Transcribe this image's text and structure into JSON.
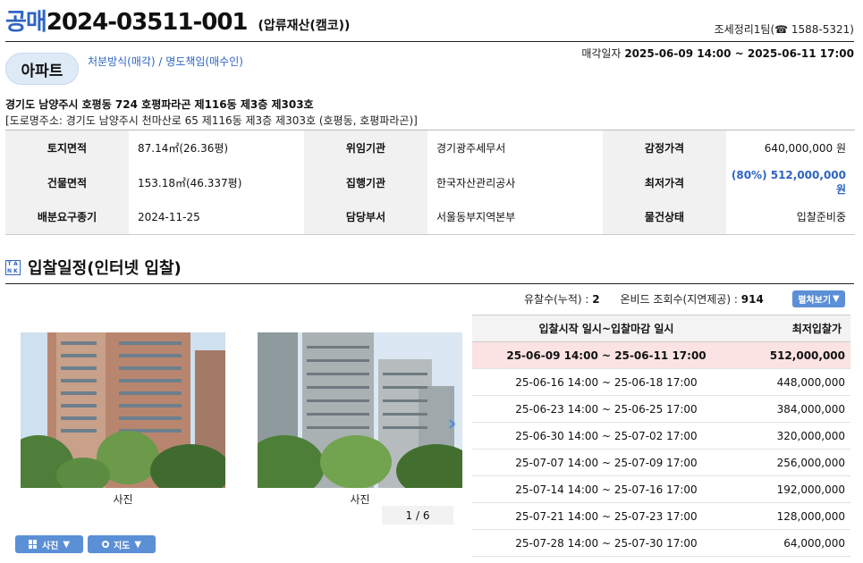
{
  "header": {
    "type_label": "공매",
    "case_number": "2024-03511-001",
    "subtitle": "(압류재산(캠코))",
    "contact": "조세정리1팀(☎ 1588-5321)"
  },
  "badge": {
    "label": "아파트"
  },
  "disposal": "처분방식(매각) / 명도책임(매수인)",
  "sale_period": {
    "label": "매각일자",
    "value": "2025-06-09 14:00 ~ 2025-06-11 17:00"
  },
  "address": {
    "lot": "경기도 남양주시 호평동 724 호평파라곤 제116동 제3층 제303호",
    "road": "[도로명주소: 경기도 남양주시 천마산로 65 제116동 제3층 제303호 (호평동, 호평파라곤)]"
  },
  "info": {
    "land_area_label": "토지면적",
    "land_area": "87.14㎡(26.36평)",
    "delegator_label": "위임기관",
    "delegator": "경기광주세무서",
    "appraisal_label": "감정가격",
    "appraisal": "640,000,000 원",
    "building_area_label": "건물면적",
    "building_area": "153.18㎡(46.337평)",
    "executor_label": "집행기관",
    "executor": "한국자산관리공사",
    "min_price_label": "최저가격",
    "min_price": "(80%) 512,000,000 원",
    "deadline_label": "배분요구종기",
    "deadline": "2024-11-25",
    "department_label": "담당부서",
    "department": "서울동부지역본부",
    "status_label": "물건상태",
    "status": "입찰준비중"
  },
  "section": {
    "title": "입찰일정(인터넷 입찰)",
    "icon_letters": [
      "T",
      "A",
      "N",
      "K"
    ]
  },
  "stats": {
    "failed_label": "유찰수(누적) :",
    "failed": "2",
    "views_label": "온비드 조회수(지연제공) :",
    "views": "914",
    "expand_label": "펼쳐보기"
  },
  "gallery": {
    "caption1": "사진",
    "caption2": "사진",
    "pager": "1 / 6",
    "photo_button": "사진",
    "map_button": "지도"
  },
  "schedule": {
    "headers": [
      "입찰시작 일시~입찰마감 일시",
      "최저입찰가"
    ],
    "rows": [
      {
        "period": "25-06-09 14:00 ~ 25-06-11 17:00",
        "price": "512,000,000"
      },
      {
        "period": "25-06-16 14:00 ~ 25-06-18 17:00",
        "price": "448,000,000"
      },
      {
        "period": "25-06-23 14:00 ~ 25-06-25 17:00",
        "price": "384,000,000"
      },
      {
        "period": "25-06-30 14:00 ~ 25-07-02 17:00",
        "price": "320,000,000"
      },
      {
        "period": "25-07-07 14:00 ~ 25-07-09 17:00",
        "price": "256,000,000"
      },
      {
        "period": "25-07-14 14:00 ~ 25-07-16 17:00",
        "price": "192,000,000"
      },
      {
        "period": "25-07-21 14:00 ~ 25-07-23 17:00",
        "price": "128,000,000"
      },
      {
        "period": "25-07-28 14:00 ~ 25-07-30 17:00",
        "price": "64,000,000"
      }
    ]
  },
  "colors": {
    "accent": "#2f64c2",
    "button": "#5b8fd6",
    "current_row": "#fbe3e3"
  }
}
